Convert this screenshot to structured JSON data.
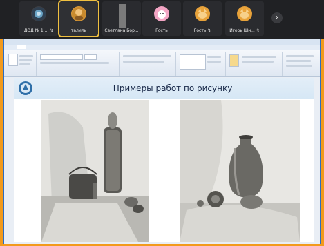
{
  "participants": [
    {
      "name": "ДОД № 1 ... ↯",
      "avatar_color": "#3e3f44",
      "active": false
    },
    {
      "name": "талиль",
      "avatar_color": "#d99a3b",
      "active": true
    },
    {
      "name": "Светлана Бор...",
      "avatar_color": "#8a8a8a",
      "active": false
    },
    {
      "name": "Гость",
      "avatar_color": "#f3a5c4",
      "active": false
    },
    {
      "name": "Гость ↯",
      "avatar_color": "#e8a23a",
      "active": false
    },
    {
      "name": "Игорь Шн... ↯",
      "avatar_color": "#e8a23a",
      "active": false
    }
  ],
  "next_icon": "chevron-right-icon",
  "slide": {
    "title": "Примеры работ по рисунку"
  },
  "colors": {
    "frame": "#f29a1c",
    "strip": "#202124",
    "active_outline": "#f0c040"
  }
}
